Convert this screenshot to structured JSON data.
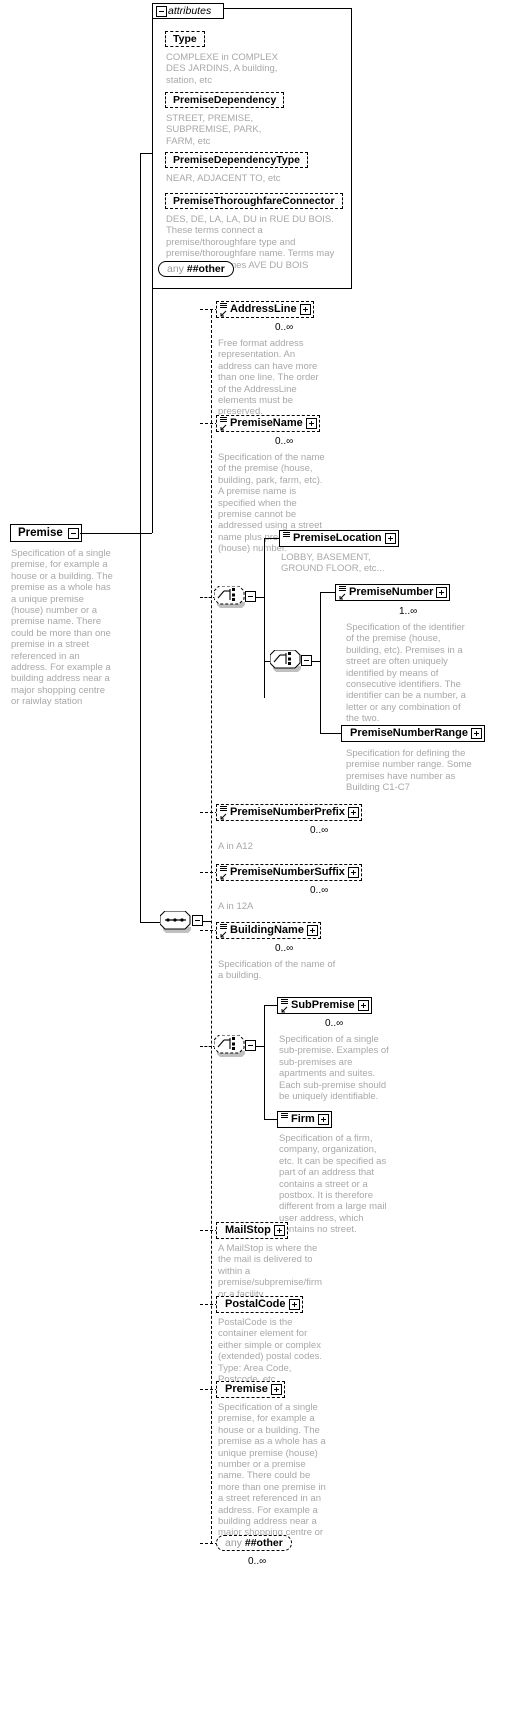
{
  "diagram": {
    "kind": "xsd-schema-diagram",
    "root": {
      "name": "Premise",
      "annotation": "Specification of a single premise, for example a house or a building. The premise as a whole has a unique premise (house) number or a premise name. There could be more than one premise in a street referenced in an address. For example a building address near a major shopping centre or raiwlay station",
      "toggle": "minus"
    },
    "attributes_group": {
      "label": "attributes",
      "toggle": "minus",
      "items": [
        {
          "name": "Type",
          "annotation": "COMPLEXE in COMPLEX DES JARDINS, A building, station, etc"
        },
        {
          "name": "PremiseDependency",
          "annotation": "STREET, PREMISE, SUBPREMISE, PARK, FARM, etc"
        },
        {
          "name": "PremiseDependencyType",
          "annotation": "NEAR, ADJACENT TO, etc"
        },
        {
          "name": "PremiseThoroughfareConnector",
          "annotation": "DES, DE, LA, LA, DU in RUE DU BOIS. These terms connect a premise/thoroughfare type and premise/thoroughfare name. Terms may appear with names AVE DU BOIS"
        }
      ],
      "any": {
        "prefix": "any",
        "value": "##other"
      }
    },
    "elements": [
      {
        "id": "address-line",
        "name": "AddressLine",
        "occurrence": "0..∞",
        "annotation": "Free format address representation. An address can have more than one line. The order of the AddressLine elements must be preserved."
      },
      {
        "id": "premise-name",
        "name": "PremiseName",
        "occurrence": "0..∞",
        "annotation": "Specification of the name of the premise (house, building, park, farm, etc). A premise name is specified when the premise cannot be addressed using a street name plus premise (house) number."
      },
      {
        "id": "premise-location",
        "name": "PremiseLocation",
        "occurrence": "",
        "annotation": "LOBBY, BASEMENT, GROUND FLOOR, etc..."
      },
      {
        "id": "premise-number",
        "name": "PremiseNumber",
        "occurrence": "1..∞",
        "annotation": "Specification of the identifier of the premise (house, building, etc). Premises in a street are often uniquely identified by means of consecutive identifiers. The identifier can be a number, a letter or any combination of the two."
      },
      {
        "id": "premise-number-range",
        "name": "PremiseNumberRange",
        "occurrence": "",
        "annotation": "Specification for defining the premise number range. Some premises have number as Building C1-C7"
      },
      {
        "id": "premise-number-prefix",
        "name": "PremiseNumberPrefix",
        "occurrence": "0..∞",
        "annotation": "A in A12"
      },
      {
        "id": "premise-number-suffix",
        "name": "PremiseNumberSuffix",
        "occurrence": "0..∞",
        "annotation": "A in 12A"
      },
      {
        "id": "building-name",
        "name": "BuildingName",
        "occurrence": "0..∞",
        "annotation": "Specification of the name of a building."
      },
      {
        "id": "sub-premise",
        "name": "SubPremise",
        "occurrence": "0..∞",
        "annotation": "Specification of a single sub-premise. Examples of sub-premises are apartments and suites. Each sub-premise should be uniquely identifiable."
      },
      {
        "id": "firm",
        "name": "Firm",
        "occurrence": "",
        "annotation": "Specification of a firm, company, organization, etc. It can be specified as part of an address that contains a street or a postbox. It is therefore different from a large mail user address, which contains no street."
      },
      {
        "id": "mail-stop",
        "name": "MailStop",
        "occurrence": "",
        "annotation": "A MailStop is where the the mail is delivered to within a premise/subpremise/firm or a facility."
      },
      {
        "id": "postal-code",
        "name": "PostalCode",
        "occurrence": "",
        "annotation": "PostalCode is the container element for either simple or complex (extended) postal codes. Type: Area Code, Postcode, etc."
      },
      {
        "id": "premise-child",
        "name": "Premise",
        "occurrence": "",
        "annotation": "Specification of a single premise, for example a house or a building. The premise as a whole has a unique premise (house) number or a premise name. There could be more than one premise in a street referenced in an address. For example a building address near a major shopping centre or raiwlay station"
      },
      {
        "id": "any-other",
        "name": "##other",
        "prefix": "any",
        "occurrence": "0..∞",
        "annotation": ""
      }
    ],
    "compositors": [
      {
        "id": "choice-location-number",
        "type": "choice",
        "toggle": "minus"
      },
      {
        "id": "choice-number-range",
        "type": "choice",
        "toggle": "minus"
      },
      {
        "id": "sequence-root",
        "type": "sequence",
        "toggle": "minus"
      },
      {
        "id": "choice-subpremise-firm",
        "type": "choice",
        "toggle": "minus"
      }
    ],
    "colors": {
      "line": "#000000",
      "annotation_text": "#a8a8a8",
      "shadow": "#c0c0c0",
      "background": "#ffffff"
    }
  }
}
